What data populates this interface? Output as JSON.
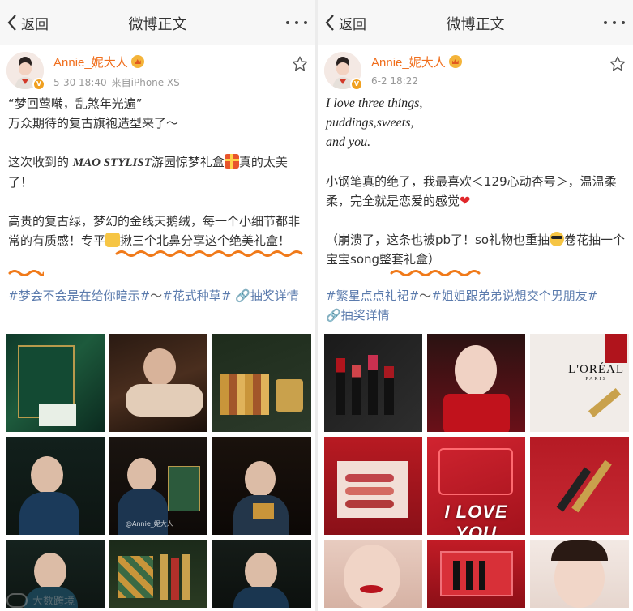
{
  "left": {
    "nav": {
      "back_label": "返回",
      "title": "微博正文"
    },
    "user": {
      "name": "Annie_妮大人",
      "date": "5-30 18:40",
      "source": "来自iPhone XS"
    },
    "body": {
      "line1": "“梦回莺啭，乱煞年光遍”",
      "line2": "万众期待的复古旗袍造型来了～",
      "line3a": "这次收到的 ",
      "brand": "MAO STYLIST",
      "line3b": "游园惊梦礼盒",
      "line3c": "真的太美了！",
      "line4a": "高贵的复古绿，梦幻的金线天鹅绒，每一个小细节都非常的有质感！专平",
      "line4b": "揪三个北鼻分享这个绝美礼盒！"
    },
    "tags": [
      "#梦会不会是在给你暗示#",
      "～",
      "#花式种草#",
      "🔗抽奖详情"
    ],
    "photos": [
      {
        "name": "green-giftbox-photo"
      },
      {
        "name": "qipao-model-lying-photo"
      },
      {
        "name": "eyeshadow-palette-photo"
      },
      {
        "name": "model-with-pipe-photo"
      },
      {
        "name": "model-with-giftbox-photo",
        "watermark": "@Annie_妮大人"
      },
      {
        "name": "model-holding-palette-photo"
      },
      {
        "name": "model-portrait-photo"
      },
      {
        "name": "lipstick-set-photo"
      },
      {
        "name": "model-closeup-photo"
      }
    ]
  },
  "right": {
    "nav": {
      "back_label": "返回",
      "title": "微博正文"
    },
    "user": {
      "name": "Annie_妮大人",
      "date": "6-2 18:22"
    },
    "body": {
      "poem1": "I love three things,",
      "poem2": "puddings,sweets,",
      "poem3": "and you.",
      "line1": "小钢笔真的绝了，我最喜欢＜129心动杏号＞，温温柔柔，完全就是恋爱的感觉",
      "line2a": "（崩溃了，这条也被pb了！so礼物也重抽",
      "line2b": "卷花抽一个宝宝song整套礼盒）"
    },
    "tags": [
      "#繁星点点礼裙#",
      "～",
      "#姐姐跟弟弟说想交个男朋友#",
      "🔗抽奖详情"
    ],
    "photos": [
      {
        "name": "lipsticks-row-photo"
      },
      {
        "name": "model-red-portrait-photo"
      },
      {
        "name": "loreal-lipstick-photo",
        "brand": "L'ORÉAL",
        "brand_sub": "PARIS"
      },
      {
        "name": "lip-swatches-photo"
      },
      {
        "name": "i-love-you-giftbox-photo",
        "caption": "I LOVE YOU"
      },
      {
        "name": "lipstick-closeup-photo"
      },
      {
        "name": "model-lips-photo"
      },
      {
        "name": "red-giftbox-set-photo"
      },
      {
        "name": "model-smile-photo"
      }
    ]
  },
  "watermark": "大数跨境",
  "colors": {
    "username": "#f06e1c",
    "link": "#5b7bad",
    "underline": "#f07a1a",
    "navbar": "#f7f7f7"
  }
}
